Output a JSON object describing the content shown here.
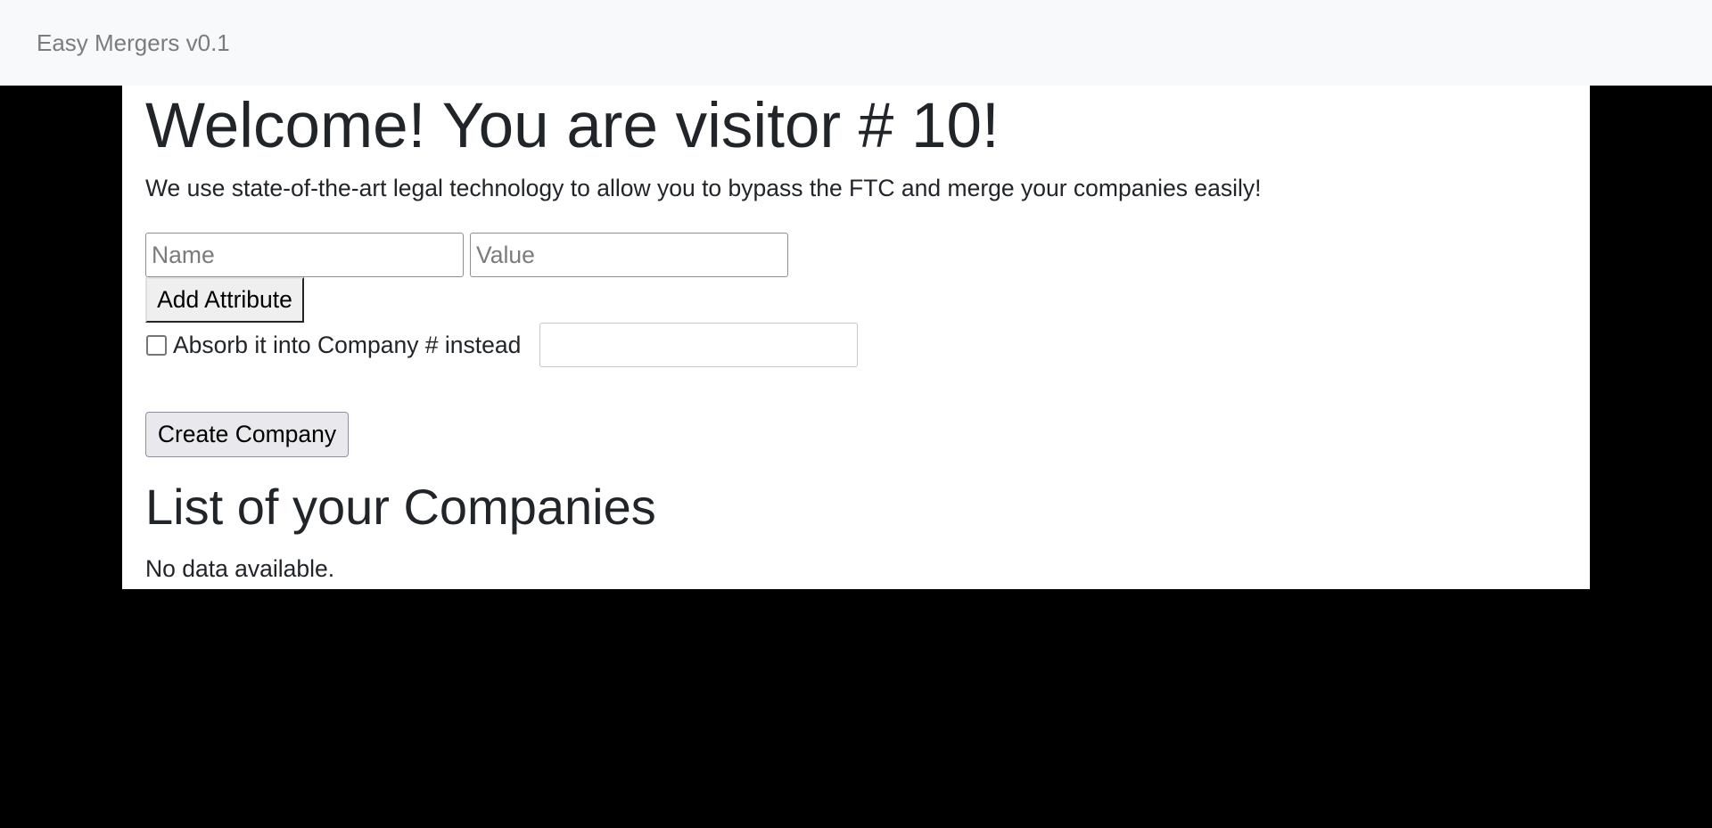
{
  "navbar": {
    "brand": "Easy Mergers v0.1"
  },
  "hero": {
    "welcome": "Welcome! You are visitor # 10!",
    "lead": "We use state-of-the-art legal technology to allow you to bypass the FTC and merge your companies easily!"
  },
  "form": {
    "name_placeholder": "Name",
    "name_value": "",
    "value_placeholder": "Value",
    "value_value": "",
    "add_attribute_label": "Add Attribute",
    "absorb_label": "Absorb it into Company # instead",
    "absorb_checked": false,
    "absorb_company_value": "",
    "create_label": "Create Company"
  },
  "companies": {
    "heading": "List of your Companies",
    "empty_message": "No data available."
  }
}
